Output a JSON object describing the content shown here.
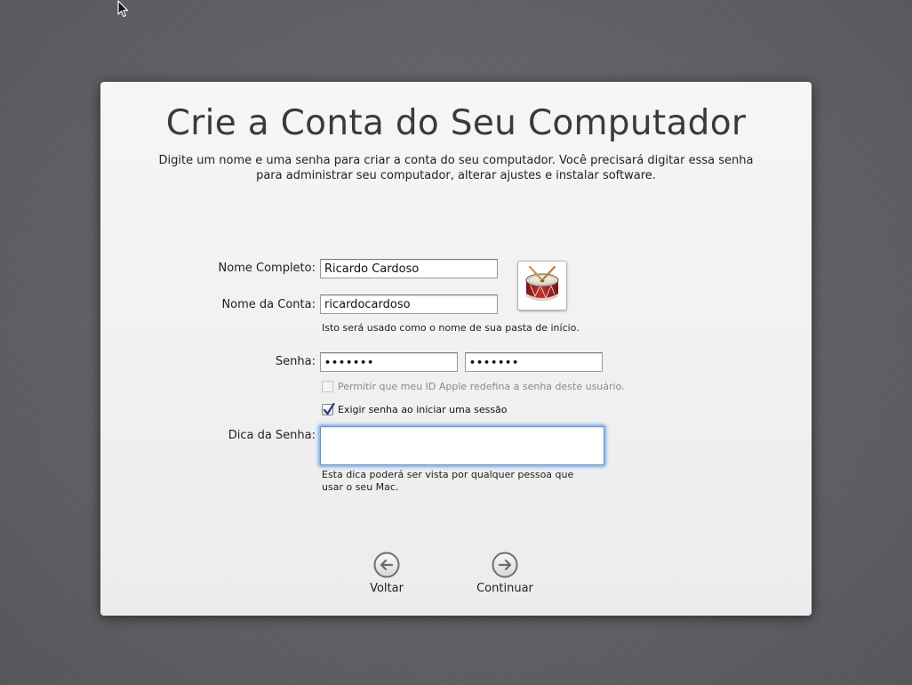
{
  "window": {
    "title": "Crie a Conta do Seu Computador",
    "subtitle": "Digite um nome e uma senha para criar a conta do seu computador. Você precisará digitar essa senha para administrar seu computador, alterar ajustes e instalar software."
  },
  "form": {
    "full_name": {
      "label": "Nome Completo:",
      "value": "Ricardo Cardoso"
    },
    "account_name": {
      "label": "Nome da Conta:",
      "value": "ricardocardoso",
      "note": "Isto será usado como o nome de sua pasta de início."
    },
    "password": {
      "label": "Senha:",
      "value": "•••••••",
      "verify_value": "•••••••"
    },
    "allow_apple_id_reset": {
      "label": "Permitir que meu ID Apple redefina a senha deste usuário.",
      "checked": false,
      "enabled": false
    },
    "require_password_login": {
      "label": "Exigir senha ao iniciar uma sessão",
      "checked": true,
      "enabled": true
    },
    "hint": {
      "label": "Dica da Senha:",
      "value": "",
      "note": "Esta dica poderá ser vista por qualquer pessoa que usar o seu Mac."
    },
    "avatar_icon": "drum-icon"
  },
  "navigation": {
    "back_label": "Voltar",
    "continue_label": "Continuar"
  },
  "colors": {
    "background": "#5e6064",
    "panel": "#f2f2f2",
    "focus_ring": "#9cc0ec",
    "checkbox_check": "#1f3f7a",
    "drum_red": "#b8262a"
  }
}
